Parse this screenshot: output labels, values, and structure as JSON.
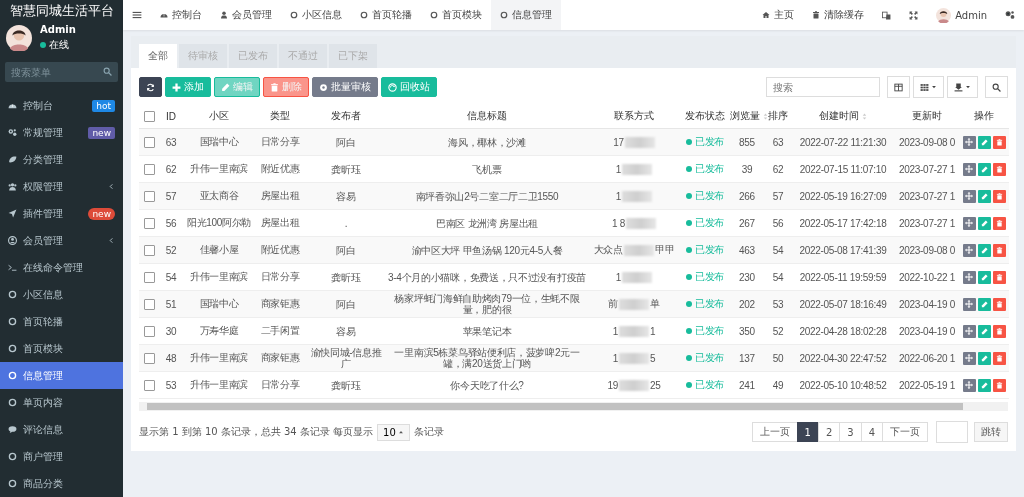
{
  "sidebar": {
    "title": "智慧同城生活平台",
    "user": {
      "name": "Admin",
      "status": "在线"
    },
    "search": {
      "placeholder": "搜索菜单"
    },
    "items": [
      {
        "label": "控制台",
        "kind": "dashboard",
        "badge": {
          "text": "hot",
          "color": "#1e88e5",
          "kind": "square"
        },
        "selected": false
      },
      {
        "label": "常规管理",
        "kind": "gears",
        "badge": {
          "text": "new",
          "color": "#605ca8",
          "kind": "square"
        },
        "selected": false
      },
      {
        "label": "分类管理",
        "kind": "leaf",
        "selected": false
      },
      {
        "label": "权限管理",
        "kind": "group",
        "expandable": true,
        "selected": false
      },
      {
        "label": "插件管理",
        "kind": "rocket",
        "badge": {
          "text": "new",
          "color": "#dd4b39",
          "kind": "pill"
        },
        "selected": false
      },
      {
        "label": "会员管理",
        "kind": "user-circle",
        "expandable": true,
        "selected": false
      },
      {
        "label": "在线命令管理",
        "kind": "terminal",
        "selected": false
      },
      {
        "label": "小区信息",
        "kind": "circle",
        "selected": false
      },
      {
        "label": "首页轮播",
        "kind": "circle",
        "selected": false
      },
      {
        "label": "首页模块",
        "kind": "circle",
        "selected": false
      },
      {
        "label": "信息管理",
        "kind": "circle",
        "selected": true
      },
      {
        "label": "单页内容",
        "kind": "circle",
        "selected": false
      },
      {
        "label": "评论信息",
        "kind": "comment",
        "selected": false
      },
      {
        "label": "商户管理",
        "kind": "circle",
        "selected": false
      },
      {
        "label": "商品分类",
        "kind": "circle",
        "selected": false
      }
    ]
  },
  "topbar": {
    "tabs": [
      {
        "label": "控制台",
        "kind": "dashboard",
        "selected": false
      },
      {
        "label": "会员管理",
        "kind": "user",
        "selected": false
      },
      {
        "label": "小区信息",
        "kind": "circle",
        "selected": false
      },
      {
        "label": "首页轮播",
        "kind": "circle",
        "selected": false
      },
      {
        "label": "首页模块",
        "kind": "circle",
        "selected": false
      },
      {
        "label": "信息管理",
        "kind": "circle",
        "selected": true
      }
    ],
    "links": [
      {
        "label": "主页",
        "kind": "home"
      },
      {
        "label": "清除缓存",
        "kind": "trash"
      }
    ],
    "user": "Admin"
  },
  "filter_tabs": [
    {
      "label": "全部",
      "selected": true
    },
    {
      "label": "待审核",
      "selected": false
    },
    {
      "label": "已发布",
      "selected": false
    },
    {
      "label": "不通过",
      "selected": false
    },
    {
      "label": "已下架",
      "selected": false
    }
  ],
  "toolbar": {
    "buttons": [
      {
        "kind": "refresh",
        "color": "#3c4454",
        "disabled": false
      },
      {
        "kind": "add",
        "label": "添加",
        "color": "#18bc9c",
        "disabled": false
      },
      {
        "kind": "edit",
        "label": "编辑",
        "color": "#18bc9c",
        "disabled": true
      },
      {
        "kind": "delete",
        "label": "删除",
        "color": "#f75444",
        "disabled": true
      },
      {
        "kind": "review",
        "label": "批量审核",
        "color": "#757b8b",
        "disabled": false
      },
      {
        "kind": "recycle",
        "label": "回收站",
        "color": "#18bc9c",
        "disabled": false
      }
    ],
    "search": {
      "placeholder": "搜索"
    }
  },
  "table": {
    "all_checked": false,
    "columns": [
      {
        "label": "ID"
      },
      {
        "label": "小区"
      },
      {
        "label": "类型"
      },
      {
        "label": "发布者"
      },
      {
        "label": "信息标题"
      },
      {
        "label": "联系方式"
      },
      {
        "label": "发布状态"
      },
      {
        "label": "浏览量",
        "sortable": true
      },
      {
        "label": "排序"
      },
      {
        "label": "创建时间",
        "sortable": true
      },
      {
        "label": "更新时"
      },
      {
        "label": "操作"
      }
    ],
    "rows": [
      {
        "checked": false,
        "id": "63",
        "community": "国瑞中心",
        "type": "日常分享",
        "publisher": "阿白",
        "title": "海风，椰林，沙滩",
        "contact_start": "17",
        "status": "已发布",
        "views": "855",
        "order": "63",
        "created": "2022-07-22 11:21:30",
        "updated": "2023-09-08 0"
      },
      {
        "checked": false,
        "id": "62",
        "community": "升伟一里南滨",
        "type": "附近优惠",
        "publisher": "龚昕珏",
        "title": "飞机票",
        "contact_start": "1",
        "status": "已发布",
        "views": "39",
        "order": "62",
        "created": "2022-07-15 11:07:10",
        "updated": "2023-07-27 1"
      },
      {
        "checked": false,
        "id": "57",
        "community": "亚太商谷",
        "type": "房屋出租",
        "publisher": "容易",
        "title": "南坪香弥山2号二室二厅二卫1550",
        "contact_start": "1",
        "status": "已发布",
        "views": "266",
        "order": "57",
        "created": "2022-05-19 16:27:09",
        "updated": "2023-07-27 1"
      },
      {
        "checked": false,
        "id": "56",
        "community": "阳光100阿尔勒",
        "type": "房屋出租",
        "publisher": ".",
        "title": "巴南区 龙洲湾 房屋出租",
        "contact_start": "1 8",
        "status": "已发布",
        "views": "267",
        "order": "56",
        "created": "2022-05-17 17:42:18",
        "updated": "2023-07-27 1"
      },
      {
        "checked": false,
        "id": "52",
        "community": "佳馨小屋",
        "type": "附近优惠",
        "publisher": "阿白",
        "title": "渝中区大坪 甲鱼汤锅 120元4-5人餐",
        "contact_start": "大众点",
        "contact_end": "甲甲",
        "status": "已发布",
        "views": "463",
        "order": "54",
        "created": "2022-05-08 17:41:39",
        "updated": "2023-09-08 0"
      },
      {
        "checked": false,
        "id": "54",
        "community": "升伟一里南滨",
        "type": "日常分享",
        "publisher": "龚昕珏",
        "title": "3-4个月的小猫咪，免费送，只不过没有打疫苗",
        "contact_start": "1",
        "status": "已发布",
        "views": "230",
        "order": "54",
        "created": "2022-05-11 19:59:59",
        "updated": "2022-10-22 1"
      },
      {
        "checked": false,
        "id": "51",
        "community": "国瑞中心",
        "type": "商家钜惠",
        "publisher": "阿白",
        "title": "杨家坪蚝门海鲜自助烤肉79一位，生蚝不限量，肥的很",
        "contact_start": "前",
        "contact_end": "单",
        "status": "已发布",
        "views": "202",
        "order": "53",
        "created": "2022-05-07 18:16:49",
        "updated": "2023-04-19 0"
      },
      {
        "checked": false,
        "id": "30",
        "community": "万寿华庭",
        "type": "二手闲置",
        "publisher": "容易",
        "title": "苹果笔记本",
        "contact_start": "1",
        "contact_end": "1",
        "status": "已发布",
        "views": "350",
        "order": "52",
        "created": "2022-04-28 18:02:28",
        "updated": "2023-04-19 0"
      },
      {
        "checked": false,
        "id": "48",
        "community": "升伟一里南滨",
        "type": "商家钜惠",
        "publisher": "渝快同城-信息推广",
        "title": "一里南滨5栋菜鸟驿站便利店，菠萝啤2元一罐，满20送货上门哟",
        "contact_start": "1",
        "contact_end": "5",
        "status": "已发布",
        "views": "137",
        "order": "50",
        "created": "2022-04-30 22:47:52",
        "updated": "2022-06-20 1"
      },
      {
        "checked": false,
        "id": "53",
        "community": "升伟一里南滨",
        "type": "日常分享",
        "publisher": "龚昕珏",
        "title": "你今天吃了什么?",
        "contact_start": "19",
        "contact_end": "25",
        "status": "已发布",
        "views": "241",
        "order": "49",
        "created": "2022-05-10 10:48:52",
        "updated": "2022-05-19 1"
      }
    ]
  },
  "footer": {
    "summary_before": "显示第 1 到第 10 条记录，总共 34 条记录 每页显示",
    "page_size": "10",
    "summary_after": "条记录",
    "pagination": [
      {
        "label": "上一页",
        "selected": false
      },
      {
        "label": "1",
        "selected": true
      },
      {
        "label": "2",
        "selected": false
      },
      {
        "label": "3",
        "selected": false
      },
      {
        "label": "4",
        "selected": false
      },
      {
        "label": "下一页",
        "selected": false
      }
    ],
    "jump": "跳转"
  }
}
